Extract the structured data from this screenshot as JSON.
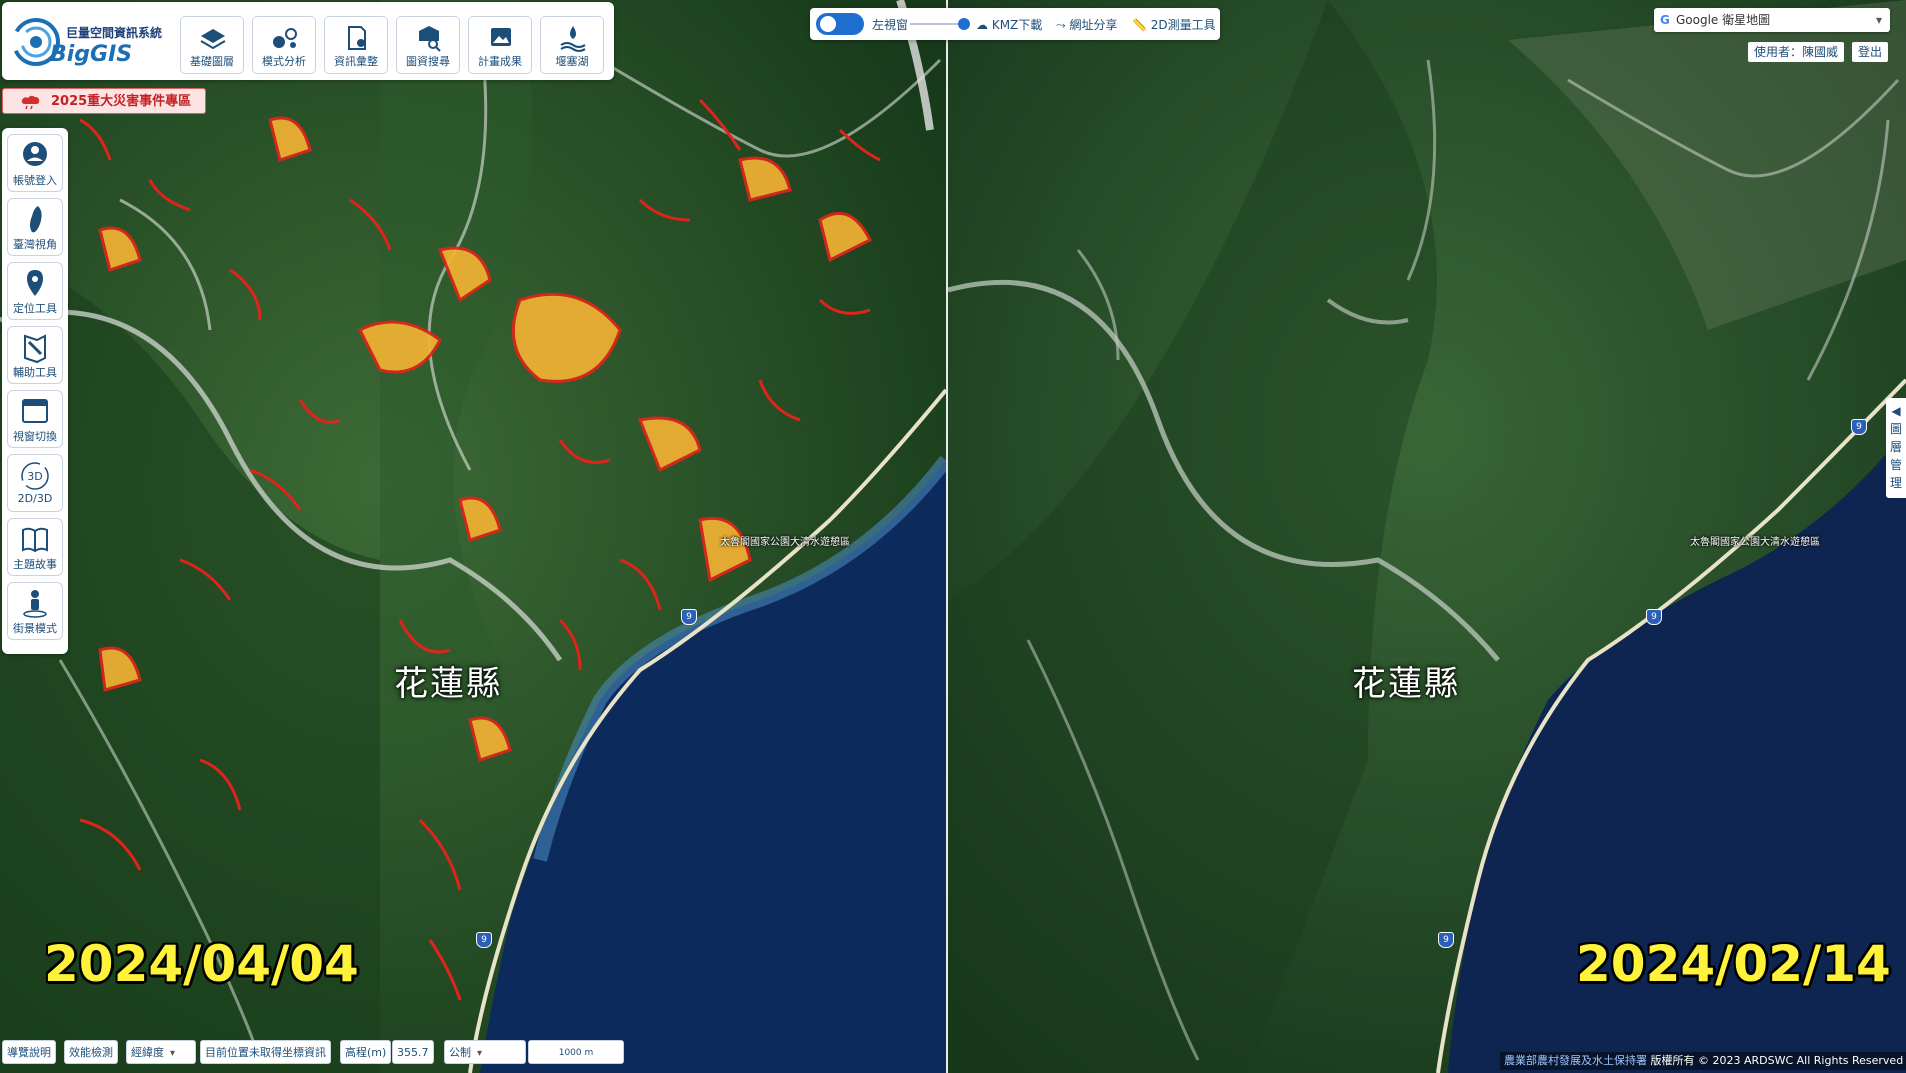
{
  "app": {
    "logo_cn": "巨量空間資訊系統",
    "logo_en": "BigGIS"
  },
  "toolbar": [
    {
      "label": "基礎圖層",
      "icon": "layers-icon"
    },
    {
      "label": "模式分析",
      "icon": "analysis-icon"
    },
    {
      "label": "資訊彙整",
      "icon": "info-summary-icon"
    },
    {
      "label": "圖資搜尋",
      "icon": "map-search-icon"
    },
    {
      "label": "計畫成果",
      "icon": "image-results-icon"
    },
    {
      "label": "堰塞湖",
      "icon": "barrier-lake-icon"
    }
  ],
  "disaster_banner": "2025重大災害事件專區",
  "sidebar": [
    {
      "label": "帳號登入",
      "icon": "user-icon"
    },
    {
      "label": "臺灣視角",
      "icon": "taiwan-icon"
    },
    {
      "label": "定位工具",
      "icon": "location-pin-icon"
    },
    {
      "label": "輔助工具",
      "icon": "tools-icon"
    },
    {
      "label": "視窗切換",
      "icon": "window-icon"
    },
    {
      "label": "2D/3D",
      "icon": "3d-icon"
    },
    {
      "label": "主題故事",
      "icon": "book-icon"
    },
    {
      "label": "街景模式",
      "icon": "street-view-icon"
    }
  ],
  "view_toolbar": {
    "left_window": "左視窗",
    "kmz": "KMZ下載",
    "share": "網址分享",
    "measure": "2D測量工具"
  },
  "basemap": {
    "selected": "Google 衛星地圖"
  },
  "user": {
    "label": "使用者：陳國威",
    "logout": "登出"
  },
  "layer_mgmt_tab": [
    "◀",
    "圖",
    "層",
    "管",
    "理"
  ],
  "map": {
    "left_date": "2024/04/04",
    "right_date": "2024/02/14",
    "county": "花蓮縣",
    "poi_park": "太魯閣國家公園大清水遊憩區",
    "road_shield": "9",
    "colors": {
      "landslide_outline": "#e0241b",
      "landslide_fill": "#f2b233",
      "ocean": "#0d2a5c",
      "forest": "#1f4a22"
    }
  },
  "status_bar": {
    "help": "導覽說明",
    "perf": "效能檢測",
    "coord_mode": "經緯度",
    "position": "目前位置未取得坐標資訊",
    "elevation_label": "高程(m)",
    "elevation_value": "355.7",
    "unit": "公制",
    "scale": "1000 m"
  },
  "copyright": {
    "org": "農業部農村發展及水土保持署",
    "text": "版權所有 © 2023 ARDSWC All Rights Reserved"
  }
}
